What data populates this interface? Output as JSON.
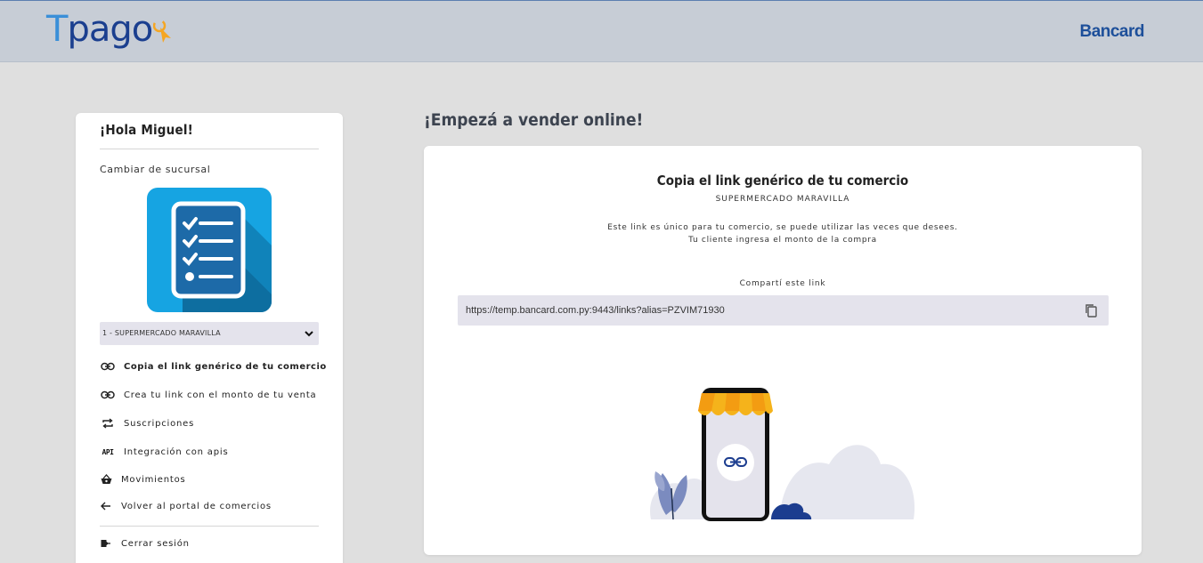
{
  "header": {
    "logo_t": "T",
    "logo_rest": "pago",
    "partner": "Bancard"
  },
  "sidebar": {
    "greeting": "¡Hola Miguel!",
    "change_branch": "Cambiar de sucursal",
    "selected_branch": "1 - SUPERMERCADO MARAVILLA",
    "items": [
      {
        "label": "Copia el link genérico de tu comercio",
        "icon": "link-icon",
        "active": true
      },
      {
        "label": "Crea tu link con el monto de tu venta",
        "icon": "link-icon",
        "active": false
      },
      {
        "label": "Suscripciones",
        "icon": "repeat-icon",
        "active": false
      },
      {
        "label": "Integración con apis",
        "icon": "api-icon",
        "active": false
      },
      {
        "label": "Movimientos",
        "icon": "basket-icon",
        "active": false
      },
      {
        "label": "Volver al portal de comercios",
        "icon": "arrow-left-icon",
        "active": false
      }
    ],
    "logout": "Cerrar sesión",
    "api_icon_text": "API"
  },
  "main": {
    "heading": "¡Empezá a vender online!",
    "card_title": "Copia el link genérico de tu comercio",
    "merchant": "SUPERMERCADO MARAVILLA",
    "desc_line1": "Este link es único para tu comercio, se puede utilizar las veces que desees.",
    "desc_line2": "Tu cliente ingresa el monto de la compra",
    "share_label": "Compartí este link",
    "link_url": "https://temp.bancard.com.py:9443/links?alias=PZVIM71930"
  },
  "colors": {
    "accent_blue": "#1b3f8f",
    "logo_light_blue": "#3a8fd8",
    "logo_orange": "#f5a623",
    "store_icon_bg": "#16a4e2",
    "awning_yellow": "#f5b31b"
  }
}
